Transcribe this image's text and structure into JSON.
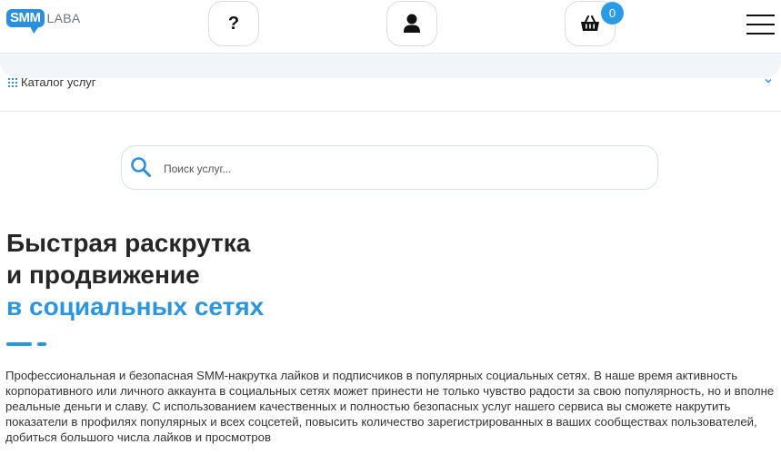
{
  "header": {
    "logo_badge": "SMM",
    "logo_text": "LABA",
    "help_label": "?",
    "cart_count": "0"
  },
  "catalog": {
    "label": "Каталог услуг"
  },
  "search": {
    "placeholder": "Поиск услуг..."
  },
  "hero": {
    "line1": "Быстрая раскрутка",
    "line2": "и продвижение",
    "line3": "в социальных сетях",
    "accent_color": "#2b96e0"
  },
  "description": "Профессиональная и безопасная SMM-накрутка лайков и подписчиков в популярных социальных сетях. В наше время активность корпоративного или личного аккаунта в социальных сетях может принести не только чувство радости за свою популярность, но и вполне реальные деньги и славу. С использованием качественных и полностью безопасных услуг нашего сервиса вы сможете накрутить показатели в профилях популярных и всех соцсетей, повысить количество зарегистрированных в ваших сообществах пользователей, добиться большого числа лайков и просмотров",
  "icons": [
    "grid-icon",
    "chevron-down-icon",
    "search-icon",
    "user-icon",
    "basket-icon",
    "menu-icon"
  ]
}
